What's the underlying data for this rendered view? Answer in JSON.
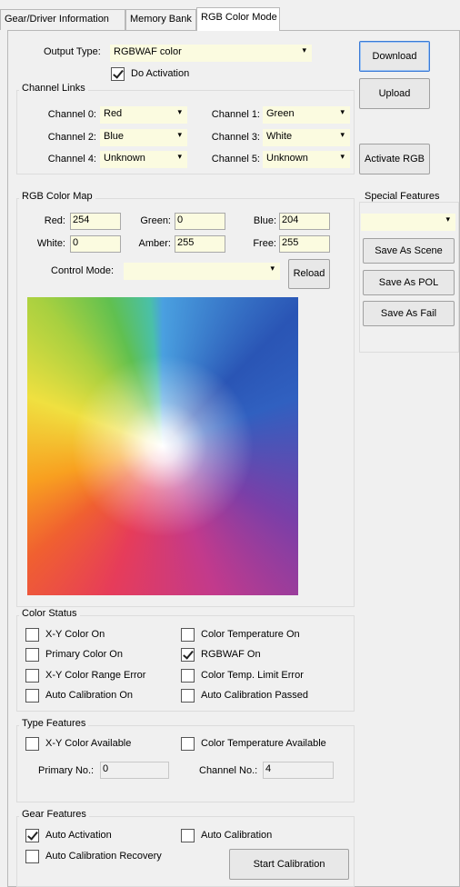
{
  "tabs": [
    "Gear/Driver Information",
    "Memory Bank",
    "RGB Color Mode"
  ],
  "output_type": {
    "label": "Output Type:",
    "value": "RGBWAF color"
  },
  "do_activation": {
    "label": "Do Activation",
    "checked": true
  },
  "channel_links": {
    "title": "Channel Links",
    "channels": [
      {
        "label": "Channel 0:",
        "value": "Red"
      },
      {
        "label": "Channel 1:",
        "value": "Green"
      },
      {
        "label": "Channel 2:",
        "value": "Blue"
      },
      {
        "label": "Channel 3:",
        "value": "White"
      },
      {
        "label": "Channel 4:",
        "value": "Unknown"
      },
      {
        "label": "Channel 5:",
        "value": "Unknown"
      }
    ]
  },
  "buttons": {
    "download": "Download",
    "upload": "Upload",
    "activate_rgb": "Activate RGB",
    "reload": "Reload",
    "save_scene": "Save As Scene",
    "save_pol": "Save As POL",
    "save_fail": "Save As Fail",
    "start_calibration": "Start Calibration"
  },
  "rgb_map": {
    "title": "RGB Color Map",
    "red": {
      "label": "Red:",
      "value": "254"
    },
    "green": {
      "label": "Green:",
      "value": "0"
    },
    "blue": {
      "label": "Blue:",
      "value": "204"
    },
    "white": {
      "label": "White:",
      "value": "0"
    },
    "amber": {
      "label": "Amber:",
      "value": "255"
    },
    "free": {
      "label": "Free:",
      "value": "255"
    },
    "control_mode": {
      "label": "Control Mode:",
      "value": ""
    }
  },
  "special_features": {
    "title": "Special Features",
    "value": ""
  },
  "color_status": {
    "title": "Color Status",
    "items": [
      {
        "label": "X-Y Color On",
        "checked": false
      },
      {
        "label": "Color Temperature On",
        "checked": false
      },
      {
        "label": "Primary Color On",
        "checked": false
      },
      {
        "label": "RGBWAF On",
        "checked": true
      },
      {
        "label": "X-Y Color Range Error",
        "checked": false
      },
      {
        "label": "Color Temp. Limit Error",
        "checked": false
      },
      {
        "label": "Auto Calibration On",
        "checked": false
      },
      {
        "label": "Auto Calibration Passed",
        "checked": false
      }
    ]
  },
  "type_features": {
    "title": "Type Features",
    "xy_available": "X-Y Color Available",
    "ct_available": "Color Temperature Available",
    "primary_no": {
      "label": "Primary No.:",
      "value": "0"
    },
    "channel_no": {
      "label": "Channel No.:",
      "value": "4"
    }
  },
  "gear_features": {
    "title": "Gear Features",
    "auto_activation": {
      "label": "Auto Activation",
      "checked": true
    },
    "auto_calibration": {
      "label": "Auto Calibration",
      "checked": false
    },
    "auto_cal_recovery": {
      "label": "Auto Calibration Recovery",
      "checked": false
    }
  }
}
